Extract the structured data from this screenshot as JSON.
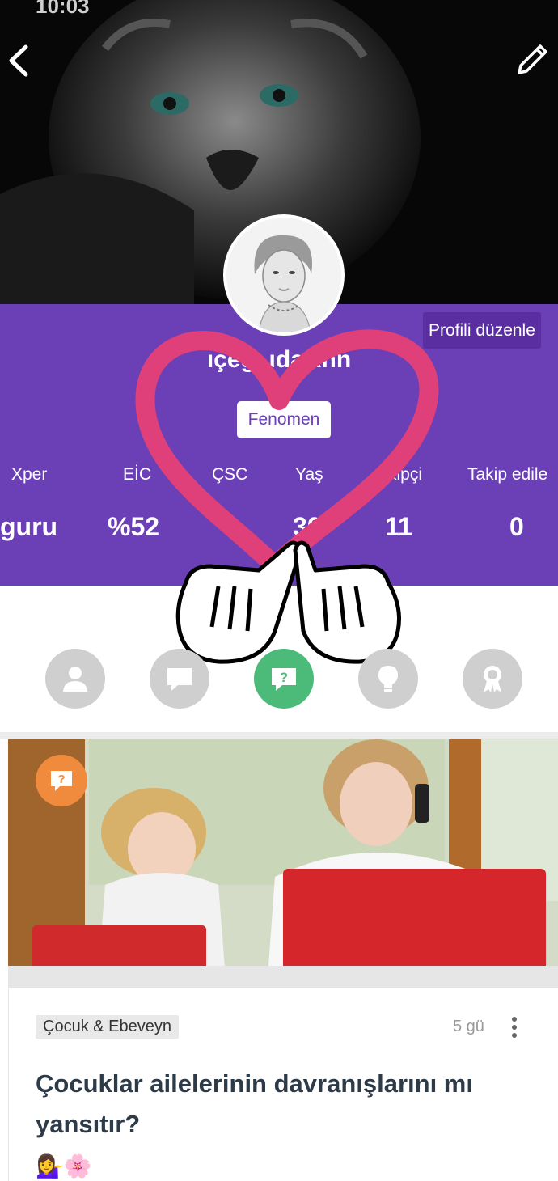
{
  "status_bar": {
    "time": "10:03"
  },
  "profile": {
    "username": "Nilçeğibarındaİdaİnn",
    "username_visible": "ıçeğı    ıdaAnn",
    "badge": "Fenomen",
    "edit_button": "Profili düzenle"
  },
  "stats": [
    {
      "label": "Xper",
      "value": "guru"
    },
    {
      "label": "EİC",
      "value": "%52"
    },
    {
      "label": "ÇSC",
      "value": ""
    },
    {
      "label": "Yaş",
      "value": "30"
    },
    {
      "label": "kipçi",
      "value": "11"
    },
    {
      "label": "Takip edile",
      "value": "0"
    }
  ],
  "tabs": [
    {
      "icon": "person-icon",
      "active": false
    },
    {
      "icon": "chat-bubble-icon",
      "active": false
    },
    {
      "icon": "question-bubble-icon",
      "active": true
    },
    {
      "icon": "lightbulb-icon",
      "active": false
    },
    {
      "icon": "award-ribbon-icon",
      "active": false
    }
  ],
  "post": {
    "category": "Çocuk & Ebeveyn",
    "time": "5 gü",
    "title": "Çocuklar ailelerinin davranışlarını mı yansıtır?",
    "emoji": "💁‍♀️🌸"
  },
  "colors": {
    "purple": "#6b3fb5",
    "green": "#4cbb7a",
    "orange": "#f08a3c",
    "heart": "#e0407a"
  }
}
